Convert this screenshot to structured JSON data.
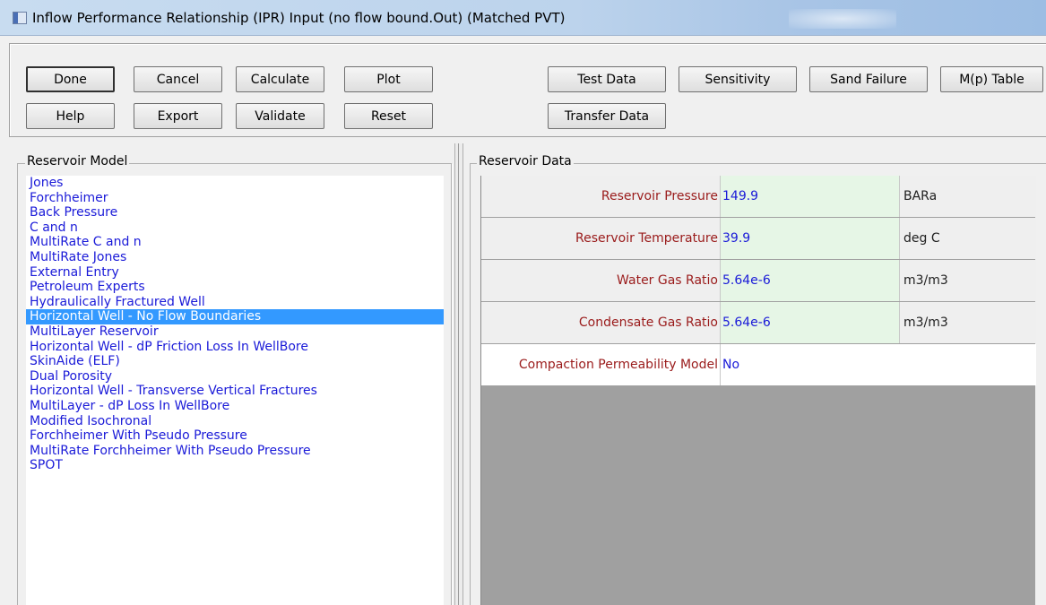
{
  "window": {
    "title": "Inflow Performance Relationship (IPR) Input (no flow bound.Out) (Matched PVT)"
  },
  "toolbar": {
    "done": "Done",
    "cancel": "Cancel",
    "calculate": "Calculate",
    "plot": "Plot",
    "test_data": "Test Data",
    "sensitivity": "Sensitivity",
    "sand_failure": "Sand Failure",
    "mp_table": "M(p) Table",
    "help": "Help",
    "export": "Export",
    "validate": "Validate",
    "reset": "Reset",
    "transfer_data": "Transfer Data"
  },
  "reservoir_model": {
    "label": "Reservoir Model",
    "selected_index": 9,
    "items": [
      "Jones",
      "Forchheimer",
      "Back Pressure",
      "C and n",
      "MultiRate C and n",
      "MultiRate Jones",
      "External Entry",
      "Petroleum Experts",
      "Hydraulically Fractured Well",
      "Horizontal Well - No Flow Boundaries",
      "MultiLayer Reservoir",
      "Horizontal Well - dP Friction Loss In WellBore",
      "SkinAide (ELF)",
      "Dual Porosity",
      "Horizontal Well - Transverse Vertical Fractures",
      "MultiLayer - dP Loss In WellBore",
      "Modified Isochronal",
      "Forchheimer With Pseudo Pressure",
      "MultiRate Forchheimer With Pseudo Pressure",
      "SPOT"
    ]
  },
  "reservoir_data": {
    "label": "Reservoir Data",
    "rows": [
      {
        "label": "Reservoir Pressure",
        "value": "149.9",
        "unit": "BARa"
      },
      {
        "label": "Reservoir Temperature",
        "value": "39.9",
        "unit": "deg C"
      },
      {
        "label": "Water Gas Ratio",
        "value": "5.64e-6",
        "unit": "m3/m3"
      },
      {
        "label": "Condensate Gas Ratio",
        "value": "5.64e-6",
        "unit": "m3/m3"
      },
      {
        "label": "Compaction Permeability Model",
        "value": "No",
        "unit": ""
      }
    ]
  },
  "colors": {
    "list_text": "#1a1ad8",
    "selection": "#3399ff",
    "grid_label": "#9a1b1b",
    "grid_value_bg": "#e6f6e6",
    "grid_empty_bg": "#a0a0a0"
  }
}
